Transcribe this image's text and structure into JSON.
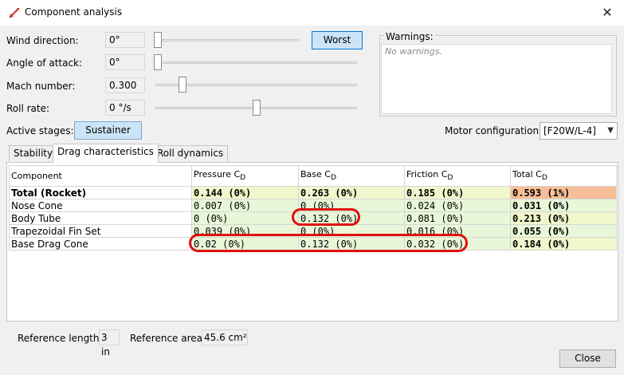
{
  "window": {
    "title": "Component analysis",
    "close_glyph": "✕"
  },
  "controls": [
    {
      "label": "Wind direction:",
      "value": "0°",
      "slider": 0.0
    },
    {
      "label": "Angle of attack:",
      "value": "0°",
      "slider": 0.0
    },
    {
      "label": "Mach number:",
      "value": "0.300",
      "slider": 0.12
    },
    {
      "label": "Roll rate:",
      "value": "0 °/s",
      "slider": 0.5
    }
  ],
  "worst_button": "Worst",
  "warnings": {
    "title": "Warnings:",
    "text": "No warnings."
  },
  "active_stages": {
    "label": "Active stages:",
    "button": "Sustainer"
  },
  "motor": {
    "label": "Motor configuration:",
    "value": "[F20W/L-4]"
  },
  "tabs": [
    "Stability",
    "Drag characteristics",
    "Roll dynamics"
  ],
  "active_tab": "Drag characteristics",
  "table": {
    "headers": [
      "Component",
      "Pressure C",
      "Base C",
      "Friction C",
      "Total C"
    ],
    "subscript": "D",
    "rows": [
      {
        "name": "Total (Rocket)",
        "pressure": "0.144  (0%)",
        "base": "0.263  (0%)",
        "friction": "0.185  (0%)",
        "total": "0.593  (1%)"
      },
      {
        "name": "Nose Cone",
        "pressure": "0.007  (0%)",
        "base": "0  (0%)",
        "friction": "0.024  (0%)",
        "total": "0.031  (0%)"
      },
      {
        "name": "Body Tube",
        "pressure": "0  (0%)",
        "base": "0.132  (0%)",
        "friction": "0.081  (0%)",
        "total": "0.213  (0%)"
      },
      {
        "name": "Trapezoidal Fin Set",
        "pressure": "0.039  (0%)",
        "base": "0  (0%)",
        "friction": "0.016  (0%)",
        "total": "0.055  (0%)"
      },
      {
        "name": "Base Drag Cone",
        "pressure": "0.02  (0%)",
        "base": "0.132  (0%)",
        "friction": "0.032  (0%)",
        "total": "0.184  (0%)"
      }
    ]
  },
  "reference": {
    "length_label": "Reference length:",
    "length_value": "3 in",
    "area_label": "Reference area:",
    "area_value": "45.6 cm²"
  },
  "close_button": "Close",
  "colors": {
    "accent": "#0078d7",
    "highlight": "#e01010",
    "cell_green": "#e8f7d8",
    "cell_yellow": "#f2f6cc",
    "cell_orange": "#f7bf98"
  }
}
